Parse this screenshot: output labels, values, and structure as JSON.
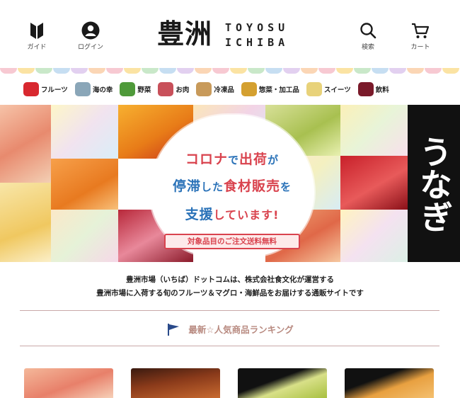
{
  "header": {
    "guide_label": "ガイド",
    "login_label": "ログイン",
    "logo_kanji": "豊洲",
    "logo_line1": "TOYOSU",
    "logo_line2": "ICHIBA",
    "search_label": "検索",
    "cart_label": "カート"
  },
  "categories": [
    {
      "label": "フルーツ",
      "icon": "apple-icon",
      "color": "#d8282f"
    },
    {
      "label": "海の幸",
      "icon": "fish-icon",
      "color": "#8aa6b8"
    },
    {
      "label": "野菜",
      "icon": "vegetable-icon",
      "color": "#4f9a3a"
    },
    {
      "label": "お肉",
      "icon": "meat-icon",
      "color": "#c8505a"
    },
    {
      "label": "冷凍品",
      "icon": "box-icon",
      "color": "#c89a5a"
    },
    {
      "label": "惣菜・加工品",
      "icon": "can-icon",
      "color": "#d4a030"
    },
    {
      "label": "スイーツ",
      "icon": "roll-cake-icon",
      "color": "#e8d27a"
    },
    {
      "label": "飲料",
      "icon": "wine-icon",
      "color": "#7a1a2a"
    }
  ],
  "hero": {
    "line1_part1": "コロナ",
    "line1_part2": "で",
    "line1_part3": "出荷",
    "line1_part4": "が",
    "line2_part1": "停滞",
    "line2_part2": "した",
    "line2_part3": "食材販売",
    "line2_part4": "を",
    "line3_part1": "支援",
    "line3_part2": "しています!",
    "ribbon": "対象品目のご注文送料無料",
    "side_text": "うなぎ"
  },
  "description": {
    "line1": "豊洲市場（いちば）ドットコムは、株式会社食文化が運営する",
    "line2": "豊洲市場に入荷する旬のフルーツ＆マグロ・海鮮品をお届けする通販サイトです"
  },
  "ranking": {
    "title": "最新☆人気商品ランキング"
  },
  "colors": {
    "accent_red": "#d9434e",
    "accent_blue": "#2a72b8",
    "ranking_title": "#b88a80",
    "rule": "#c9a9a9"
  }
}
